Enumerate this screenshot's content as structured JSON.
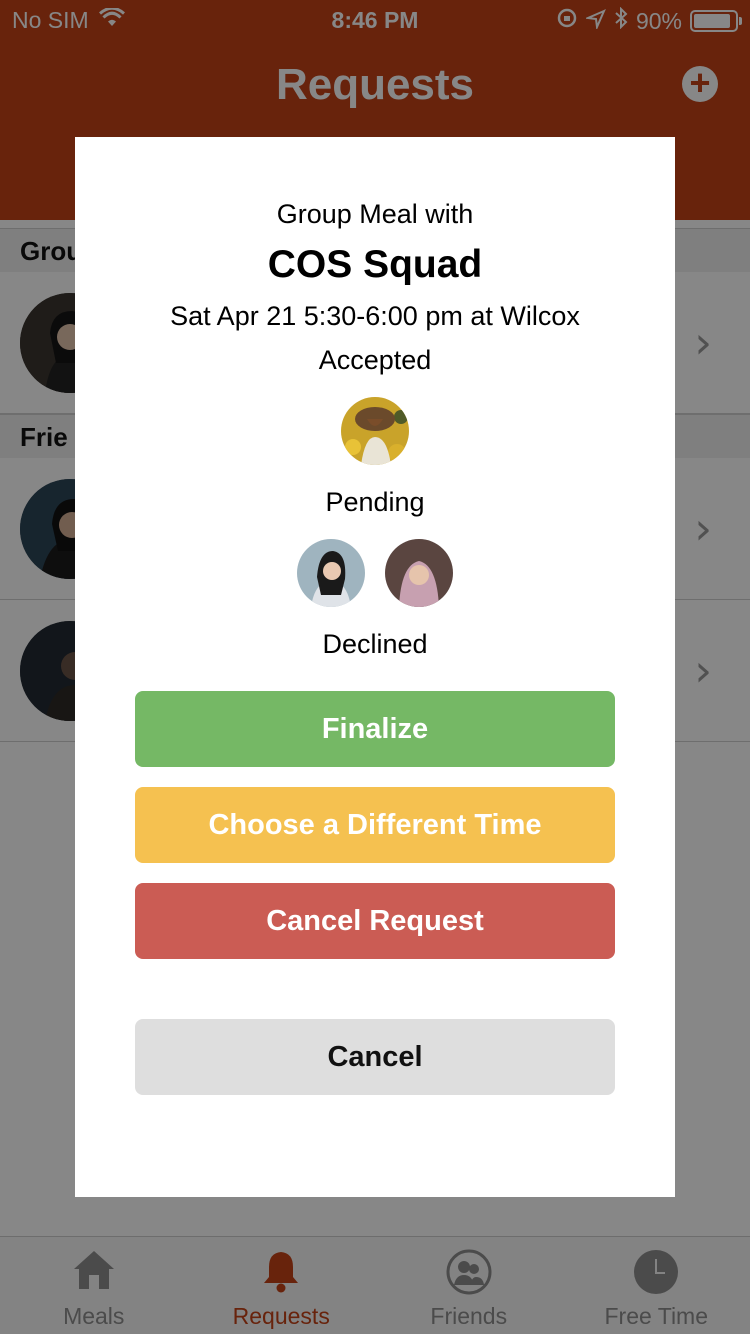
{
  "status_bar": {
    "carrier": "No SIM",
    "time": "8:46 PM",
    "battery_percent": "90%",
    "battery_level": 0.9,
    "icons": [
      "wifi-icon",
      "lock-rotation-icon",
      "location-icon",
      "bluetooth-icon",
      "battery-icon"
    ]
  },
  "nav": {
    "title": "Requests",
    "add_icon": "plus-circle-icon"
  },
  "sections": [
    {
      "header": "Grou"
    },
    {
      "header": "Frie"
    }
  ],
  "modal": {
    "subtitle": "Group Meal with",
    "title": "COS Squad",
    "when": "Sat Apr 21 5:30-6:00 pm at Wilcox",
    "accepted_label": "Accepted",
    "pending_label": "Pending",
    "declined_label": "Declined",
    "buttons": {
      "finalize": "Finalize",
      "different_time": "Choose a Different Time",
      "cancel_request": "Cancel Request",
      "cancel": "Cancel"
    }
  },
  "tabs": [
    {
      "label": "Meals",
      "icon": "house-icon",
      "active": false
    },
    {
      "label": "Requests",
      "icon": "bell-icon",
      "active": true
    },
    {
      "label": "Friends",
      "icon": "people-icon",
      "active": false
    },
    {
      "label": "Free Time",
      "icon": "clock-icon",
      "active": false
    }
  ],
  "colors": {
    "brand": "#c44318",
    "finalize": "#75b865",
    "different_time": "#f5c150",
    "cancel_request": "#cb5c54",
    "cancel": "#dedede"
  }
}
